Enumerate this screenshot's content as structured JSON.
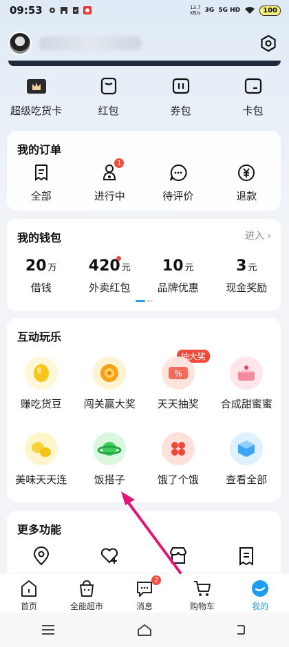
{
  "status": {
    "time": "09:53",
    "net_speed": "13.7\nKB/s",
    "net1": "3G",
    "net2": "5G HD",
    "battery": "100"
  },
  "profile": {
    "settings_icon": "hexagon-settings-icon"
  },
  "assets": [
    {
      "label": "超级吃货卡",
      "icon": "crown-card-icon"
    },
    {
      "label": "红包",
      "icon": "red-packet-icon"
    },
    {
      "label": "券包",
      "icon": "ticket-icon"
    },
    {
      "label": "卡包",
      "icon": "card-wallet-icon"
    }
  ],
  "orders": {
    "title": "我的订单",
    "items": [
      {
        "label": "全部",
        "icon": "order-list-icon"
      },
      {
        "label": "进行中",
        "icon": "rider-icon",
        "badge": "1"
      },
      {
        "label": "待评价",
        "icon": "comment-icon"
      },
      {
        "label": "退款",
        "icon": "refund-icon"
      }
    ]
  },
  "wallet": {
    "title": "我的钱包",
    "more": "进入 ›",
    "items": [
      {
        "value": "20",
        "unit": "万",
        "label": "借钱"
      },
      {
        "value": "420",
        "unit": "元",
        "label": "外卖红包"
      },
      {
        "value": "10",
        "unit": "元",
        "label": "品牌优惠"
      },
      {
        "value": "3",
        "unit": "元",
        "label": "现金奖励"
      }
    ]
  },
  "games": {
    "title": "互动玩乐",
    "ribbon": "抽大奖",
    "items": [
      {
        "label": "赚吃货豆",
        "icon": "bean-icon"
      },
      {
        "label": "闯关赢大奖",
        "icon": "orange-ball-icon"
      },
      {
        "label": "天天抽奖",
        "icon": "coupon-percent-icon"
      },
      {
        "label": "合成甜蜜蜜",
        "icon": "cake-icon"
      },
      {
        "label": "美味天天连",
        "icon": "lemons-icon"
      },
      {
        "label": "饭搭子",
        "icon": "green-planet-icon"
      },
      {
        "label": "饿了个饿",
        "icon": "hearts-icon"
      },
      {
        "label": "查看全部",
        "icon": "blue-cube-icon"
      }
    ]
  },
  "more": {
    "title": "更多功能",
    "items": [
      {
        "icon": "location-icon"
      },
      {
        "icon": "heart-plus-icon"
      },
      {
        "icon": "store-icon"
      },
      {
        "icon": "invoice-icon"
      }
    ]
  },
  "tabs": [
    {
      "label": "首页",
      "icon": "home-icon"
    },
    {
      "label": "全能超市",
      "icon": "basket-icon"
    },
    {
      "label": "消息",
      "icon": "message-icon",
      "badge": "2"
    },
    {
      "label": "购物车",
      "icon": "cart-icon"
    },
    {
      "label": "我的",
      "icon": "me-icon"
    }
  ],
  "colors": {
    "accent": "#1e9df5",
    "badge": "#f24a3d",
    "annotation_arrow": "#e0157a"
  }
}
